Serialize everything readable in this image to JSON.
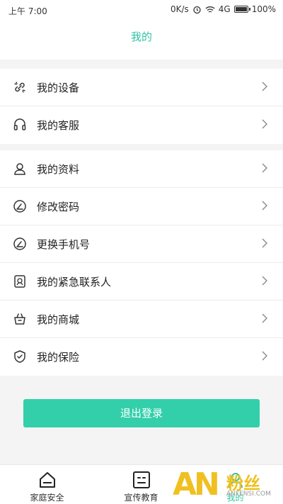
{
  "status": {
    "time": "上午 7:00",
    "speed": "0K/s",
    "network": "4G",
    "battery": "100%"
  },
  "header": {
    "title": "我的"
  },
  "menu_group1": [
    {
      "label": "我的设备",
      "icon": "link-icon"
    },
    {
      "label": "我的客服",
      "icon": "headset-icon"
    }
  ],
  "menu_group2": [
    {
      "label": "我的资料",
      "icon": "user-icon"
    },
    {
      "label": "修改密码",
      "icon": "edit-icon"
    },
    {
      "label": "更换手机号",
      "icon": "edit-icon"
    },
    {
      "label": "我的紧急联系人",
      "icon": "emergency-contact-icon"
    },
    {
      "label": "我的商城",
      "icon": "basket-icon"
    },
    {
      "label": "我的保险",
      "icon": "shield-icon"
    }
  ],
  "logout": {
    "label": "退出登录"
  },
  "tabs": [
    {
      "label": "家庭安全",
      "icon": "house-icon"
    },
    {
      "label": "宣传教育",
      "icon": "face-box-icon"
    },
    {
      "label": "我的",
      "icon": "profile-icon"
    }
  ],
  "watermark": {
    "text": "粉丝",
    "sub": "ANFENSI.COM"
  },
  "colors": {
    "accent": "#2ec4a3",
    "button": "#33cfab"
  }
}
